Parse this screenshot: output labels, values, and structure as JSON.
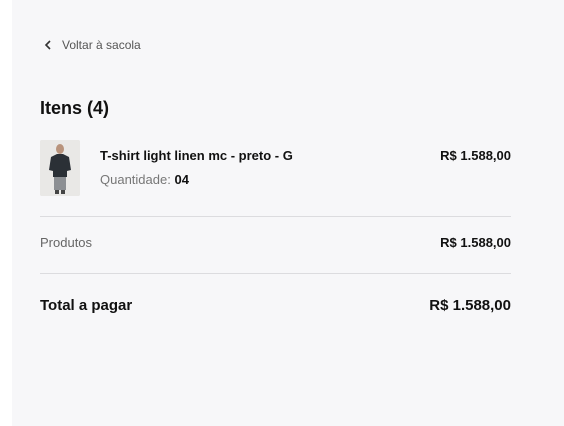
{
  "nav": {
    "back_label": "Voltar à sacola"
  },
  "cart": {
    "title": "Itens (4)",
    "items": [
      {
        "name": "T-shirt light linen mc - preto - G",
        "quantity_label": "Quantidade:",
        "quantity": "04",
        "price": "R$ 1.588,00",
        "image": "tshirt-product-photo"
      }
    ]
  },
  "summary": {
    "products_label": "Produtos",
    "products_value": "R$ 1.588,00",
    "total_label": "Total a pagar",
    "total_value": "R$ 1.588,00"
  },
  "colors": {
    "panel_bg": "#f7f7f9",
    "text": "#111111",
    "muted": "#777777",
    "divider": "#dcdcdf"
  }
}
